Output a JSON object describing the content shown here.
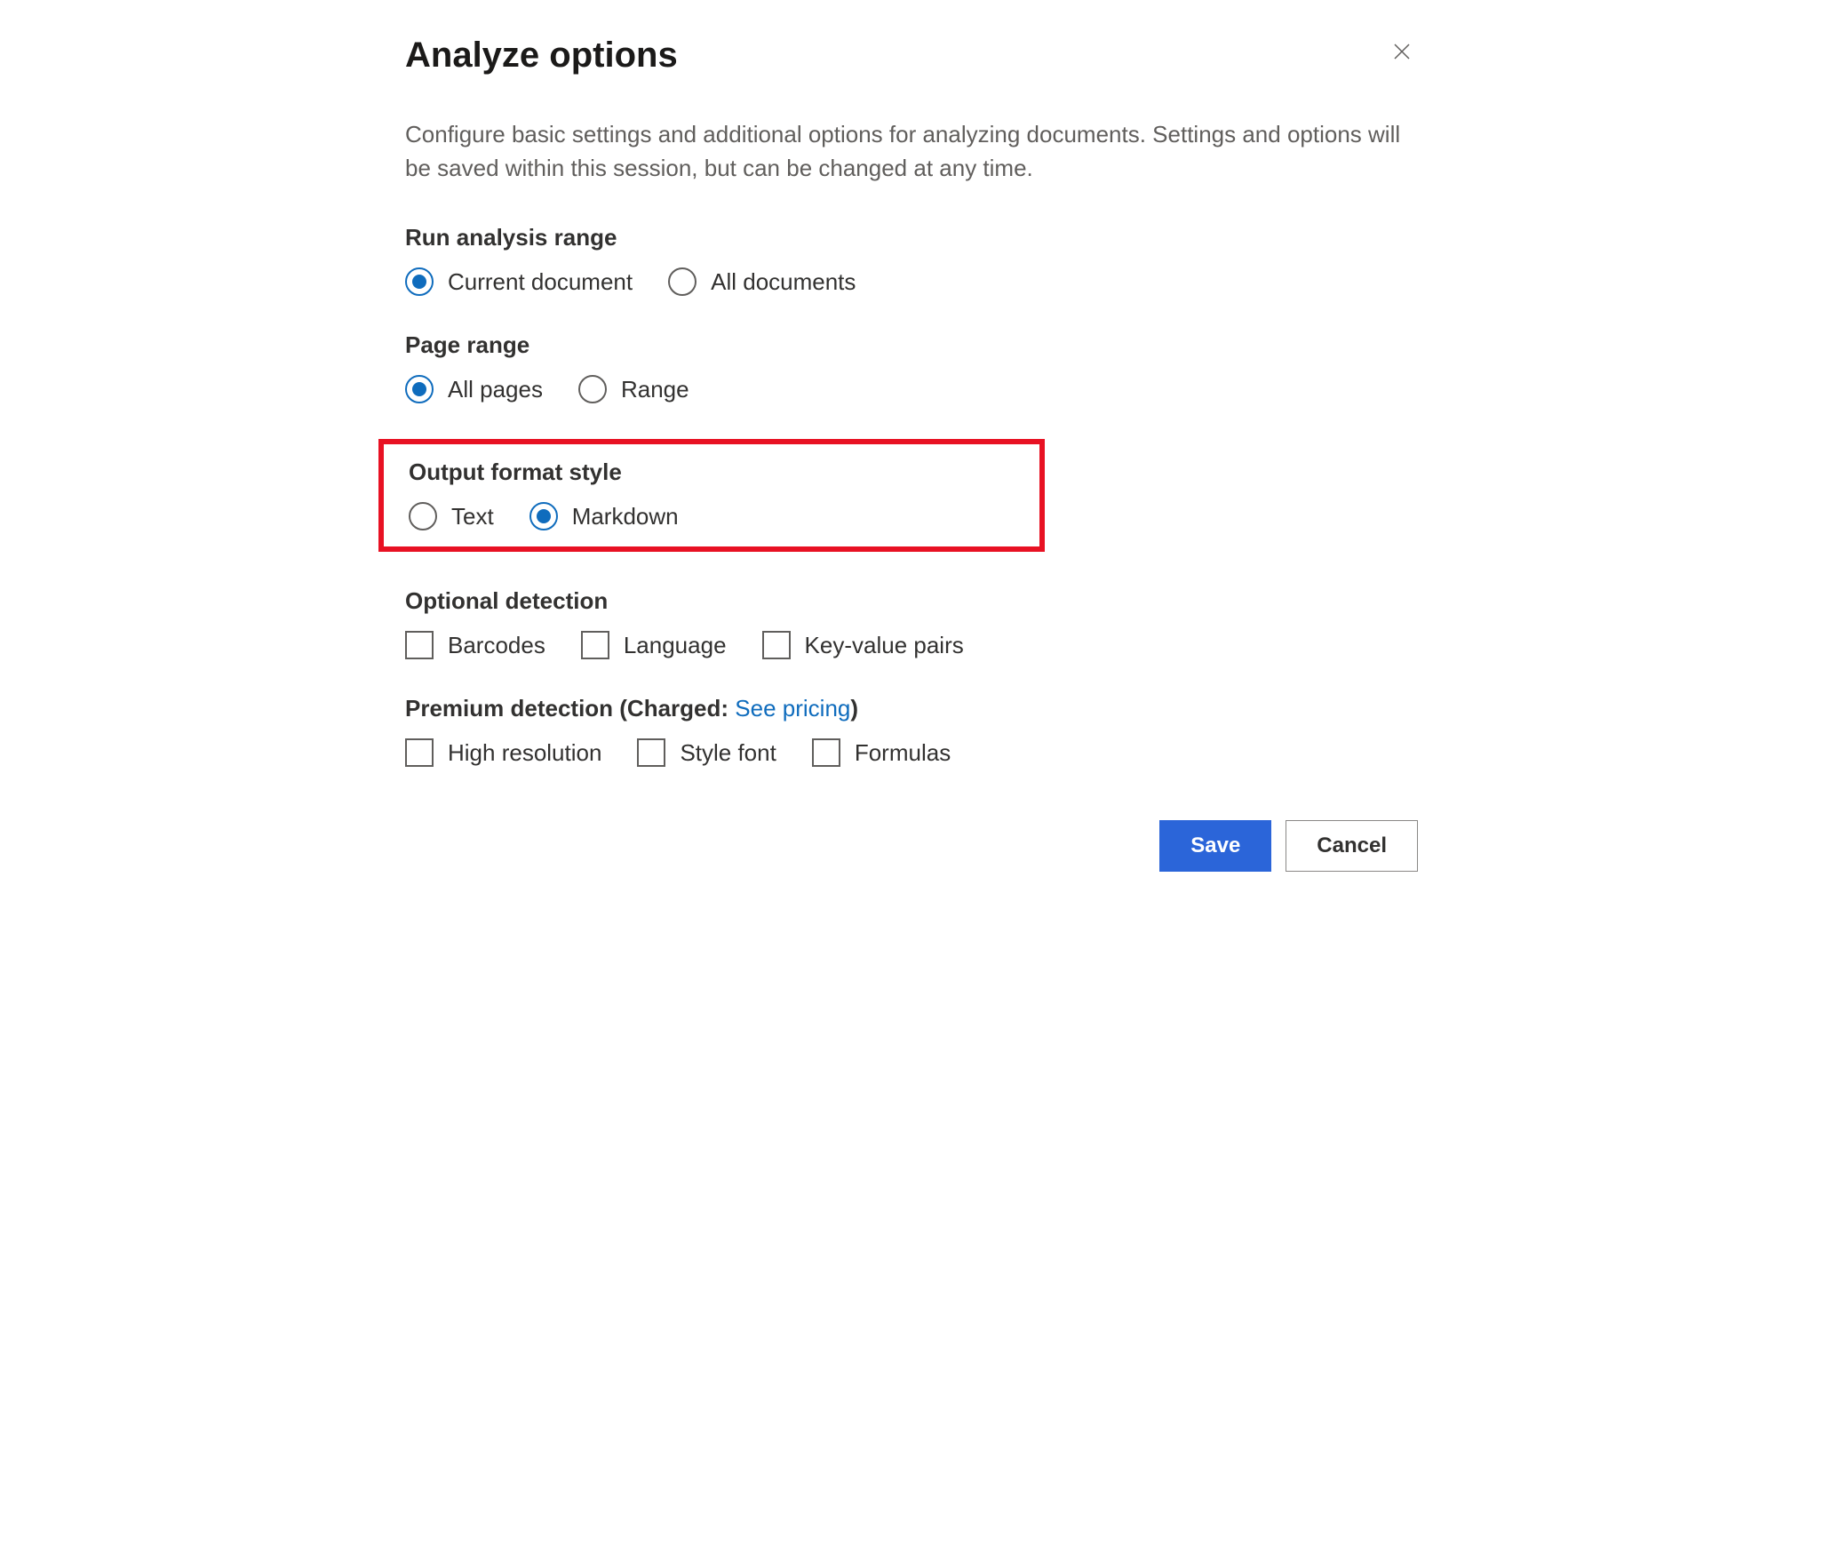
{
  "dialog": {
    "title": "Analyze options",
    "description": "Configure basic settings and additional options for analyzing documents. Settings and options will be saved within this session, but can be changed at any time."
  },
  "sections": {
    "runAnalysis": {
      "label": "Run analysis range",
      "options": [
        {
          "label": "Current document",
          "checked": true
        },
        {
          "label": "All documents",
          "checked": false
        }
      ]
    },
    "pageRange": {
      "label": "Page range",
      "options": [
        {
          "label": "All pages",
          "checked": true
        },
        {
          "label": "Range",
          "checked": false
        }
      ]
    },
    "outputFormat": {
      "label": "Output format style",
      "options": [
        {
          "label": "Text",
          "checked": false
        },
        {
          "label": "Markdown",
          "checked": true
        }
      ]
    },
    "optionalDetection": {
      "label": "Optional detection",
      "options": [
        {
          "label": "Barcodes",
          "checked": false
        },
        {
          "label": "Language",
          "checked": false
        },
        {
          "label": "Key-value pairs",
          "checked": false
        }
      ]
    },
    "premiumDetection": {
      "label_prefix": "Premium detection (Charged: ",
      "link": "See pricing",
      "label_suffix": ")",
      "options": [
        {
          "label": "High resolution",
          "checked": false
        },
        {
          "label": "Style font",
          "checked": false
        },
        {
          "label": "Formulas",
          "checked": false
        }
      ]
    }
  },
  "footer": {
    "save": "Save",
    "cancel": "Cancel"
  }
}
